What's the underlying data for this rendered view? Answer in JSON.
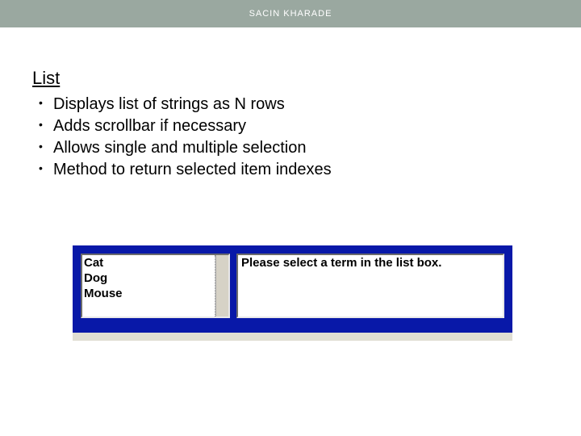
{
  "header": {
    "author": "SACIN KHARADE"
  },
  "slide": {
    "heading": "List",
    "bullets": [
      "Displays list of strings as N rows",
      "Adds scrollbar if necessary",
      "Allows single and multiple selection",
      "Method to return selected item indexes"
    ]
  },
  "widget": {
    "list_items": [
      "Cat",
      "Dog",
      "Mouse"
    ],
    "message": "Please select a term in the list box."
  },
  "colors": {
    "header_bg": "#9aa8a0",
    "panel_blue": "#0818a8"
  }
}
